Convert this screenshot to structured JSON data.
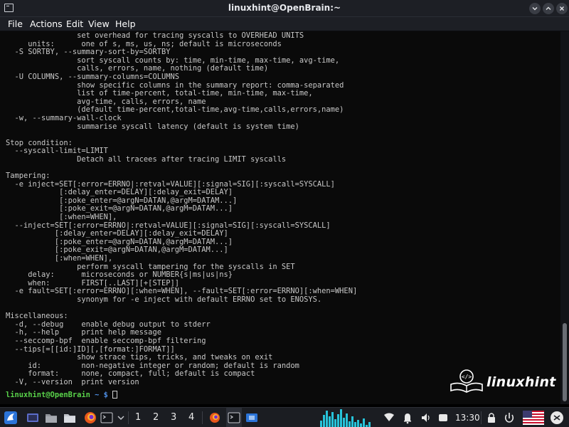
{
  "window": {
    "title": "linuxhint@OpenBrain:~"
  },
  "menu": [
    "File",
    "Actions",
    "Edit",
    "View",
    "Help"
  ],
  "terminal": {
    "lines": [
      "                set overhead for tracing syscalls to OVERHEAD UNITS",
      "     units:      one of s, ms, us, ns; default is microseconds",
      "  -S SORTBY, --summary-sort-by=SORTBY",
      "                sort syscall counts by: time, min-time, max-time, avg-time,",
      "                calls, errors, name, nothing (default time)",
      "  -U COLUMNS, --summary-columns=COLUMNS",
      "                show specific columns in the summary report: comma-separated",
      "                list of time-percent, total-time, min-time, max-time,",
      "                avg-time, calls, errors, name",
      "                (default time-percent,total-time,avg-time,calls,errors,name)",
      "  -w, --summary-wall-clock",
      "                summarise syscall latency (default is system time)",
      "",
      "Stop condition:",
      "  --syscall-limit=LIMIT",
      "                Detach all tracees after tracing LIMIT syscalls",
      "",
      "Tampering:",
      "  -e inject=SET[:error=ERRNO|:retval=VALUE][:signal=SIG][:syscall=SYSCALL]",
      "            [:delay_enter=DELAY][:delay_exit=DELAY]",
      "            [:poke_enter=@argN=DATAN,@argM=DATAM...]",
      "            [:poke_exit=@argN=DATAN,@argM=DATAM...]",
      "            [:when=WHEN],",
      "  --inject=SET[:error=ERRNO|:retval=VALUE][:signal=SIG][:syscall=SYSCALL]",
      "           [:delay_enter=DELAY][:delay_exit=DELAY]",
      "           [:poke_enter=@argN=DATAN,@argM=DATAM...]",
      "           [:poke_exit=@argN=DATAN,@argM=DATAM...]",
      "           [:when=WHEN],",
      "                perform syscall tampering for the syscalls in SET",
      "     delay:      microseconds or NUMBER{s|ms|us|ns}",
      "     when:       FIRST[..LAST][+[STEP]]",
      "  -e fault=SET[:error=ERRNO][:when=WHEN], --fault=SET[:error=ERRNO][:when=WHEN]",
      "                synonym for -e inject with default ERRNO set to ENOSYS.",
      "",
      "Miscellaneous:",
      "  -d, --debug    enable debug output to stderr",
      "  -h, --help     print help message",
      "  --seccomp-bpf  enable seccomp-bpf filtering",
      "  --tips[=[[id:]ID][,[format:]FORMAT]]",
      "                show strace tips, tricks, and tweaks on exit",
      "     id:         non-negative integer or random; default is random",
      "     format:     none, compact, full; default is compact",
      "  -V, --version  print version"
    ],
    "prompt_user": "linuxhint@OpenBrain",
    "prompt_path": "~",
    "prompt_symbol": "$"
  },
  "watermark": {
    "text": "linuxhint"
  },
  "taskbar": {
    "workspaces": [
      "1",
      "2",
      "3",
      "4"
    ],
    "clock": "13:30"
  }
}
